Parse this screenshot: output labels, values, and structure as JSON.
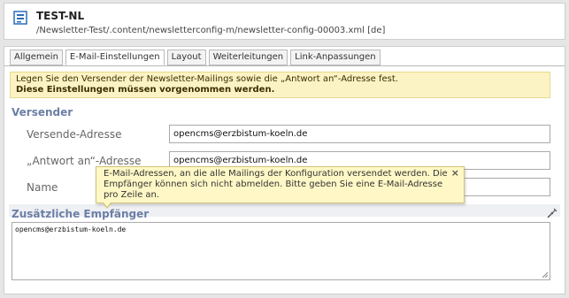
{
  "header": {
    "title": "TEST-NL",
    "path": "/Newsletter-Test/.content/newsletterconfig-m/newsletter-config-00003.xml [de]",
    "logo_icon": "file-config-icon"
  },
  "tabs": [
    {
      "label": "Allgemein"
    },
    {
      "label": "E-Mail-Einstellungen",
      "active": true
    },
    {
      "label": "Layout"
    },
    {
      "label": "Weiterleitungen"
    },
    {
      "label": "Link-Anpassungen"
    }
  ],
  "notice": {
    "line1": "Legen Sie den Versender der Newsletter-Mailings sowie die „Antwort an“-Adresse fest.",
    "line2": "Diese Einstellungen müssen vorgenommen werden."
  },
  "versender": {
    "title": "Versender",
    "fields": [
      {
        "label": "Versende-Adresse",
        "value": "opencms@erzbistum-koeln.de"
      },
      {
        "label": "„Antwort an“-Adresse",
        "value": "opencms@erzbistum-koeln.de"
      },
      {
        "label": "Name",
        "value": ""
      }
    ]
  },
  "extra": {
    "title": "Zusätzliche Empfänger",
    "value": "opencms@erzbistum-koeln.de",
    "icon": "wrench-icon"
  },
  "tooltip": {
    "text": "E-Mail-Adressen, an die alle Mailings der Konfiguration versendet werden. Die Empfänger können sich nicht abmelden. Bitte geben Sie eine E-Mail-Adresse pro Zeile an.",
    "close": "×"
  },
  "colors": {
    "section_title": "#6c7fa6",
    "notice_bg": "#fcf3c4",
    "tooltip_bg": "#fff8c6"
  }
}
